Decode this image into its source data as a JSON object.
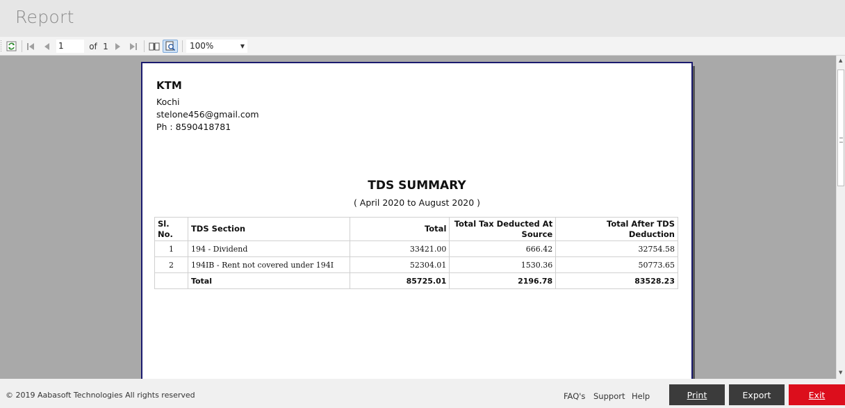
{
  "window": {
    "title": "Report"
  },
  "toolbar": {
    "page_current": "1",
    "page_of_label": "of",
    "page_total": "1",
    "zoom": "100%",
    "icons": [
      "refresh-icon",
      "first-page-icon",
      "prev-page-icon",
      "next-page-icon",
      "last-page-icon",
      "book-view-icon",
      "print-layout-icon",
      "dropdown-arrow-icon"
    ]
  },
  "report": {
    "company": "KTM",
    "city": "Kochi",
    "email": "stelone456@gmail.com",
    "phone": "Ph : 8590418781",
    "title": "TDS SUMMARY",
    "period": "( April 2020 to August 2020 )",
    "table": {
      "headers": [
        "Sl. No.",
        "TDS Section",
        "Total",
        "Total Tax Deducted At Source",
        "Total After TDS Deduction"
      ],
      "rows": [
        [
          "1",
          "194 - Dividend",
          "33421.00",
          "666.42",
          "32754.58"
        ],
        [
          "2",
          "194IB - Rent not covered under 194I",
          "52304.01",
          "1530.36",
          "50773.65"
        ]
      ],
      "total": [
        "",
        "Total",
        "85725.01",
        "2196.78",
        "83528.23"
      ]
    }
  },
  "footer": {
    "copyright": "© 2019 Aabasoft Technologies All rights reserved",
    "links": [
      "FAQ's",
      "Support",
      "Help"
    ],
    "buttons": {
      "print": "Print",
      "export": "Export",
      "exit": "Exit"
    },
    "colors": {
      "dark_button": "#3b3b3b",
      "exit_button": "#dc0e1c"
    }
  }
}
